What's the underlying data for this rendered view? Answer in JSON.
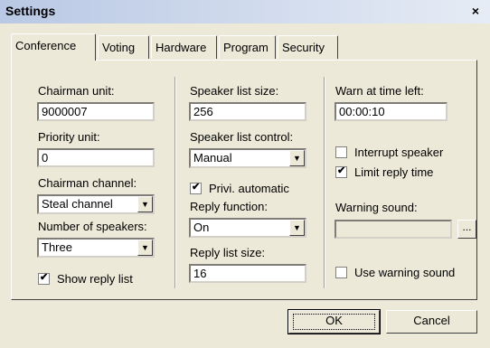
{
  "window": {
    "title": "Settings",
    "close_label": "×"
  },
  "tabs": [
    {
      "label": "Conference",
      "active": true
    },
    {
      "label": "Voting"
    },
    {
      "label": "Hardware"
    },
    {
      "label": "Program"
    },
    {
      "label": "Security"
    }
  ],
  "conference": {
    "chairman_unit": {
      "label": "Chairman unit:",
      "value": "9000007"
    },
    "priority_unit": {
      "label": "Priority unit:",
      "value": "0"
    },
    "chairman_channel": {
      "label": "Chairman channel:",
      "value": "Steal channel"
    },
    "number_of_speakers": {
      "label": "Number of speakers:",
      "value": "Three"
    },
    "show_reply_list": {
      "label": "Show reply list",
      "checked": true
    },
    "speaker_list_size": {
      "label": "Speaker list size:",
      "value": "256"
    },
    "speaker_list_control": {
      "label": "Speaker list control:",
      "value": "Manual"
    },
    "privi_automatic": {
      "label": "Privi. automatic",
      "checked": true
    },
    "reply_function": {
      "label": "Reply function:",
      "value": "On"
    },
    "reply_list_size": {
      "label": "Reply list size:",
      "value": "16"
    },
    "warn_at_time_left": {
      "label": "Warn at time left:",
      "value": "00:00:10"
    },
    "interrupt_speaker": {
      "label": "Interrupt speaker",
      "checked": false
    },
    "limit_reply_time": {
      "label": "Limit reply time",
      "checked": true
    },
    "warning_sound": {
      "label": "Warning sound:",
      "value": "",
      "browse_label": "..."
    },
    "use_warning_sound": {
      "label": "Use warning sound",
      "checked": false
    }
  },
  "buttons": {
    "ok": "OK",
    "cancel": "Cancel"
  },
  "glyphs": {
    "check": "✔",
    "dropdown": "▼"
  }
}
